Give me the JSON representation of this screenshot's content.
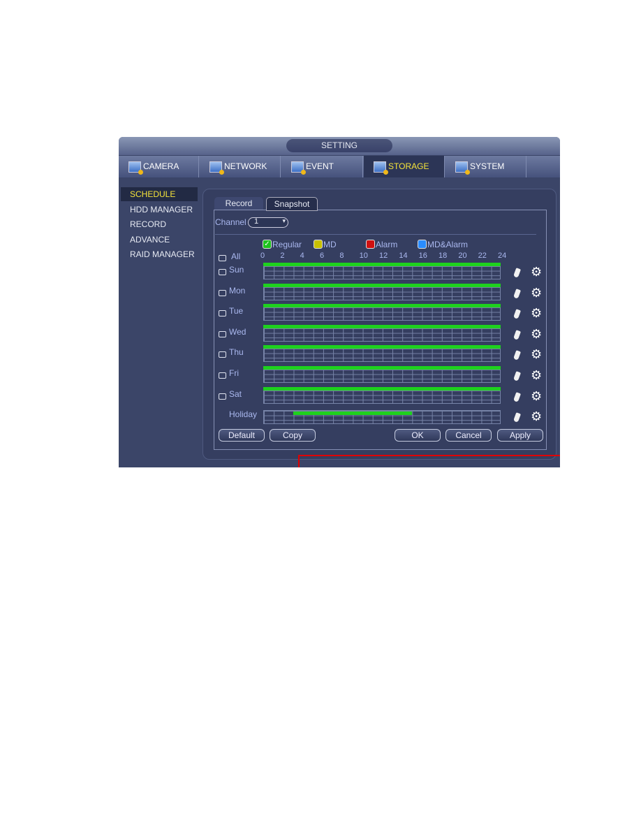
{
  "window": {
    "title": "SETTING"
  },
  "main_tabs": [
    {
      "label": "CAMERA",
      "icon": "camera-icon"
    },
    {
      "label": "NETWORK",
      "icon": "network-icon"
    },
    {
      "label": "EVENT",
      "icon": "event-icon"
    },
    {
      "label": "STORAGE",
      "icon": "storage-icon",
      "active": true
    },
    {
      "label": "SYSTEM",
      "icon": "system-icon"
    }
  ],
  "sidebar": {
    "items": [
      {
        "label": "SCHEDULE",
        "active": true
      },
      {
        "label": "HDD MANAGER"
      },
      {
        "label": "RECORD"
      },
      {
        "label": "ADVANCE"
      },
      {
        "label": "RAID MANAGER"
      }
    ]
  },
  "sub_tabs": [
    {
      "label": "Record"
    },
    {
      "label": "Snapshot",
      "active": true
    }
  ],
  "channel": {
    "label": "Channel",
    "value": "1"
  },
  "legend": [
    {
      "label": "Regular",
      "color": "#1ec21e",
      "checked": true
    },
    {
      "label": "MD",
      "color": "#c8c000"
    },
    {
      "label": "Alarm",
      "color": "#d01010"
    },
    {
      "label": "MD&Alarm",
      "color": "#2a8cff"
    }
  ],
  "all_label": "All",
  "hours": [
    "0",
    "2",
    "4",
    "6",
    "8",
    "10",
    "12",
    "14",
    "16",
    "18",
    "20",
    "22",
    "24"
  ],
  "schedule": [
    {
      "day": "Sun",
      "regular": [
        [
          0,
          24
        ]
      ]
    },
    {
      "day": "Mon",
      "regular": [
        [
          0,
          24
        ]
      ]
    },
    {
      "day": "Tue",
      "regular": [
        [
          0,
          24
        ]
      ]
    },
    {
      "day": "Wed",
      "regular": [
        [
          0,
          24
        ]
      ]
    },
    {
      "day": "Thu",
      "regular": [
        [
          0,
          24
        ]
      ]
    },
    {
      "day": "Fri",
      "regular": [
        [
          0,
          24
        ]
      ]
    },
    {
      "day": "Sat",
      "regular": [
        [
          0,
          24
        ]
      ]
    },
    {
      "day": "Holiday",
      "regular": [
        [
          3,
          15
        ]
      ],
      "highlighted": true
    }
  ],
  "buttons": {
    "default": "Default",
    "copy": "Copy",
    "ok": "OK",
    "cancel": "Cancel",
    "apply": "Apply"
  },
  "highlight_color": "#e00000"
}
